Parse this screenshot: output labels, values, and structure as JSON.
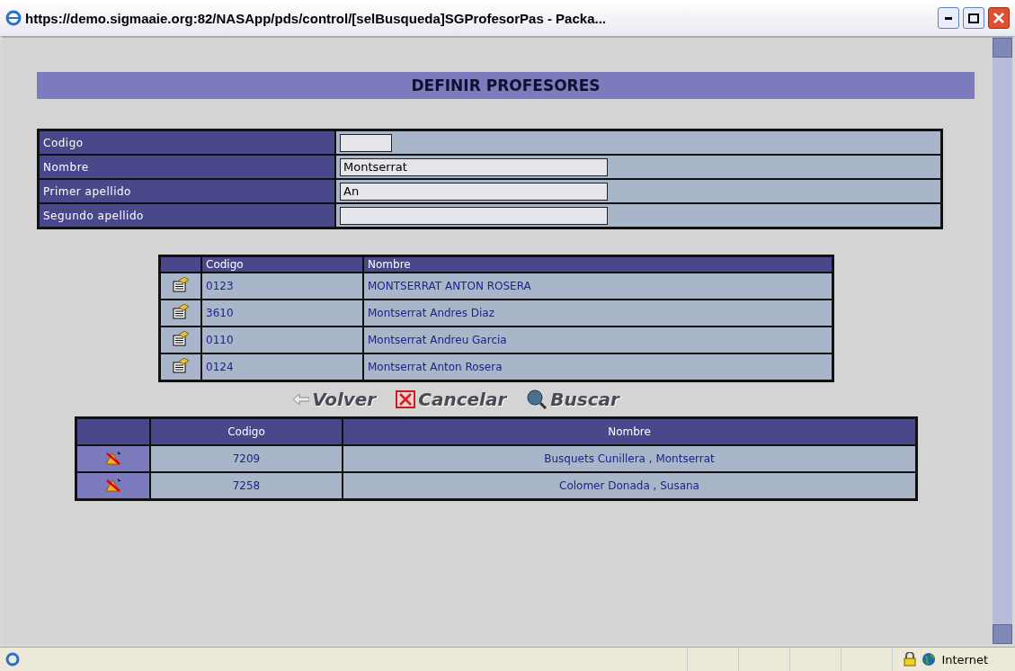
{
  "window": {
    "title": "https://demo.sigmaaie.org:82/NASApp/pds/control/[selBusqueda]SGProfesorPas - Packa..."
  },
  "page_title": "DEFINIR PROFESORES",
  "form": [
    {
      "label": "Codigo",
      "kind": "code"
    },
    {
      "label": "Nombre",
      "value": "Montserrat",
      "kind": "text"
    },
    {
      "label": "Primer apellido",
      "value": "An",
      "kind": "text"
    },
    {
      "label": "Segundo apellido",
      "kind": "text"
    }
  ],
  "results": {
    "columns": [
      "Codigo",
      "Nombre"
    ],
    "rows": [
      {
        "codigo": "0123",
        "nombre": "MONTSERRAT ANTON ROSERA"
      },
      {
        "codigo": "3610",
        "nombre": "Montserrat Andres Diaz"
      },
      {
        "codigo": "0110",
        "nombre": "Montserrat Andreu Garcia"
      },
      {
        "codigo": "0124",
        "nombre": "Montserrat Anton Rosera"
      }
    ]
  },
  "actions": [
    {
      "kind": "back",
      "label": "Volver"
    },
    {
      "kind": "cancel",
      "label": "Cancelar"
    },
    {
      "kind": "search",
      "label": "Buscar"
    }
  ],
  "selected": {
    "columns": [
      "Codigo",
      "Nombre"
    ],
    "rows": [
      {
        "codigo": "7209",
        "nombre": "Busquets Cunillera , Montserrat"
      },
      {
        "codigo": "7258",
        "nombre": "Colomer Donada , Susana"
      }
    ]
  },
  "status_bar": {
    "zone": "Internet"
  }
}
